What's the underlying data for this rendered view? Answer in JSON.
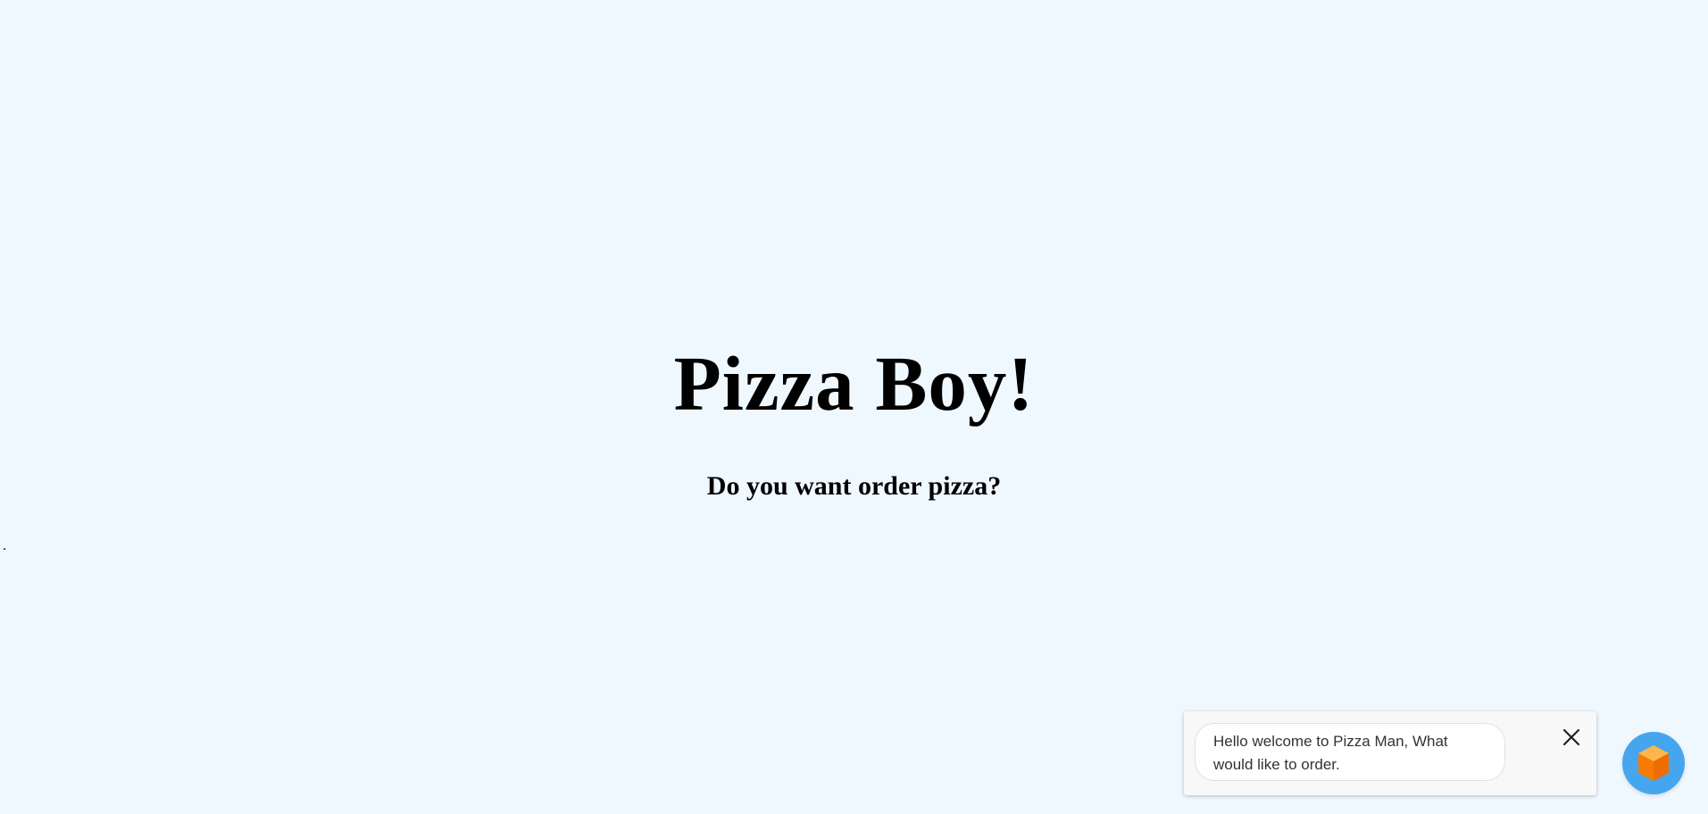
{
  "hero": {
    "title": "Pizza Boy!",
    "subtitle": "Do you want order pizza?"
  },
  "stray_text": ".",
  "chat": {
    "message": "Hello welcome to Pizza Man, What would like to order.",
    "close_icon": "close-icon",
    "launcher_icon": "cube-icon",
    "launcher_color": "#45a6ef",
    "icon_color": "#f57c00"
  }
}
